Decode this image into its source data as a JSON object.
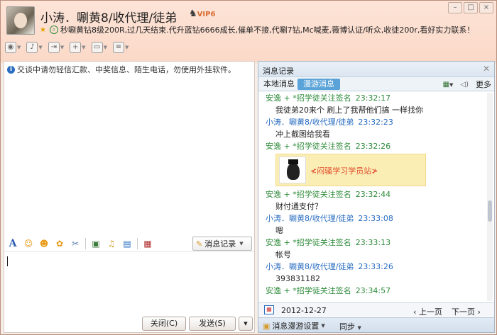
{
  "header": {
    "contact_name": "小涛．唰黄8/收代理/徒弟",
    "vip_badge": "VIP6",
    "signature": "秒唰黄钻8级200R,过几天结束.代升蓝钻6666成长,催单不接,代唰7钻,Mc喊麦,薇博认证/听众,收徒200r,看好实力联系！"
  },
  "window_controls": {
    "minimize": "–",
    "maximize": "□",
    "close": "×"
  },
  "toolbar": {
    "items": [
      "video",
      "voice",
      "transfer-file",
      "add-friend",
      "remote-desktop",
      "more-apps"
    ]
  },
  "left": {
    "notice": "交谈中请勿轻信汇款、中奖信息、陌生电话，勿使用外挂软件。",
    "message_record_btn": "消息记录",
    "close_btn": "关闭(C)",
    "send_btn": "发送(S)"
  },
  "history": {
    "title": "消息记录",
    "tab_local": "本地消息",
    "tab_roam": "漫游消息",
    "more": "更多",
    "messages": [
      {
        "sender": "安逸 + *招学徒关注签名",
        "time": "23:32:17",
        "text": "我徒弟20来个 刷上了我帮他们搞  一样找你",
        "me": false
      },
      {
        "sender": "小涛．唰黄8/收代理/徒弟",
        "time": "23:32:23",
        "text": "冲上截图给我看",
        "me": true
      },
      {
        "sender": "安逸 + *招学徒关注签名",
        "time": "23:32:26",
        "text": "",
        "me": false,
        "card": "≮闷骚学习学员站≯"
      },
      {
        "sender": "安逸 + *招学徒关注签名",
        "time": "23:32:44",
        "text": "财付通支付？",
        "me": false
      },
      {
        "sender": "小涛．唰黄8/收代理/徒弟",
        "time": "23:33:08",
        "text": "嗯",
        "me": true
      },
      {
        "sender": "安逸 + *招学徒关注签名",
        "time": "23:33:13",
        "text": "帐号",
        "me": false
      },
      {
        "sender": "小涛．唰黄8/收代理/徒弟",
        "time": "23:33:26",
        "text": "393831182",
        "me": true
      },
      {
        "sender": "安逸 + *招学徒关注签名",
        "time": "23:34:57",
        "text": "",
        "me": false
      }
    ],
    "date": "2012-12-27",
    "prev": "上一页",
    "next": "下一页",
    "roam_settings": "消息漫游设置",
    "sync": "同步"
  }
}
